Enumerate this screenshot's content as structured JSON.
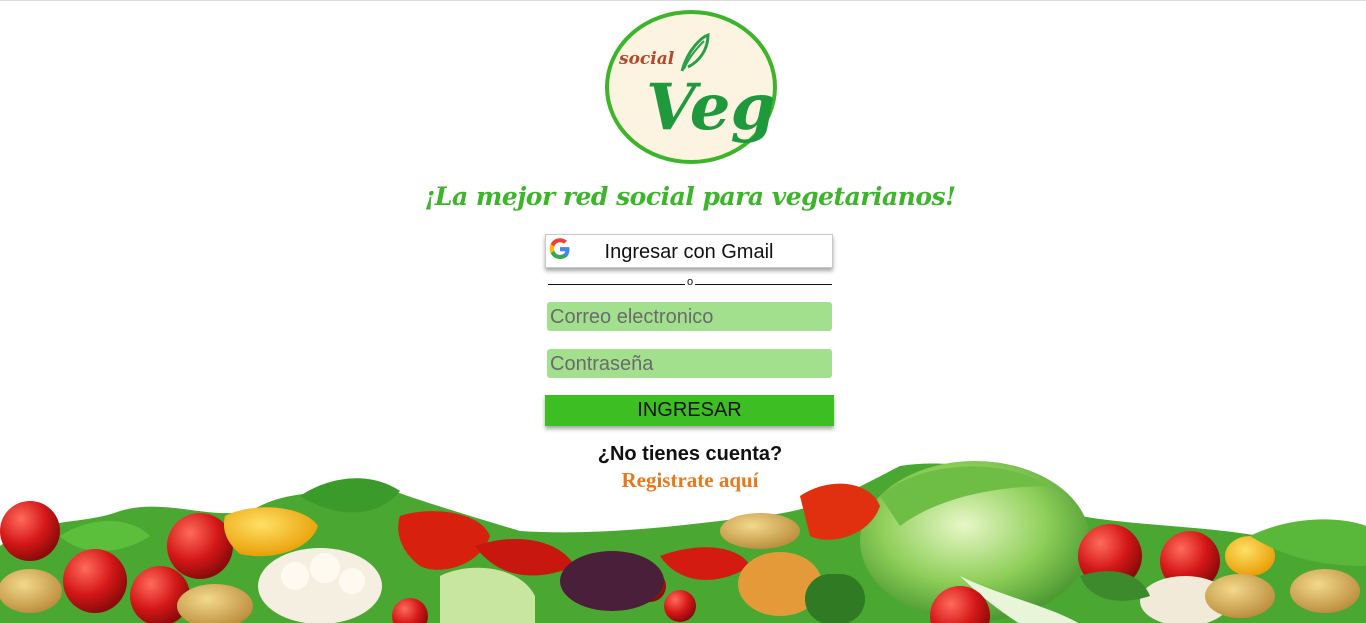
{
  "logo": {
    "small_text": "social",
    "big_text": "Veg",
    "colors": {
      "ring": "#3cb52a",
      "fill": "#fdf3e1",
      "small_text": "#b5472a",
      "big_text": "#1e9a3c"
    }
  },
  "tagline": "¡La mejor red social para vegetarianos!",
  "gmail_button": {
    "label": "Ingresar con Gmail",
    "icon": "google-g-icon"
  },
  "divider": {
    "label": "o"
  },
  "email_input": {
    "placeholder": "Correo electronico",
    "value": ""
  },
  "password_input": {
    "placeholder": "Contraseña",
    "value": ""
  },
  "submit_button": {
    "label": "INGRESAR"
  },
  "signup": {
    "question": "¿No tienes cuenta?",
    "link": "Registrate aquí"
  },
  "colors": {
    "accent_green": "#3cb52a",
    "input_bg": "#a2e08e",
    "button_green": "#3dbf23",
    "link_orange": "#e8781c"
  }
}
